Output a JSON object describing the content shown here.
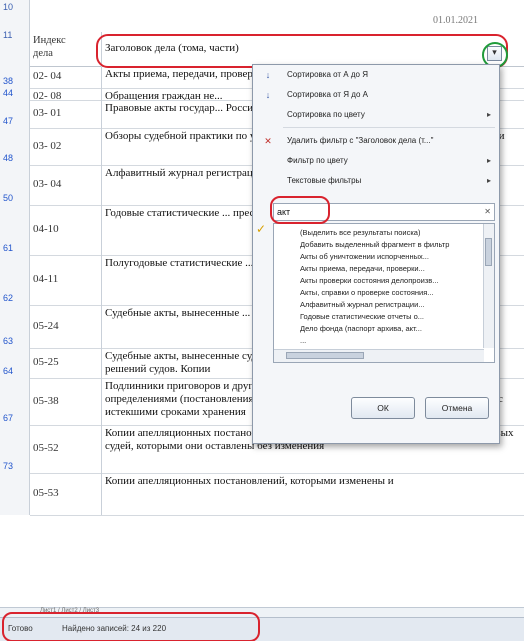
{
  "sheet": {
    "top_row_num": "10",
    "top_right_date": "01.01.2021",
    "header_row_num": "11",
    "header_index": "Индекс\nдела",
    "header_title": "Заголовок дела (тома, части)"
  },
  "rows": [
    {
      "num": "38",
      "idx": "02- 04",
      "text": "Акты приема, передачи, проверки ... смене"
    },
    {
      "num": "44",
      "idx": "02- 08",
      "text": "Обращения граждан не..."
    },
    {
      "num": "47",
      "idx": "03- 01",
      "text": "Правовые акты государ... Российской Федерации"
    },
    {
      "num": "48",
      "idx": "03- 02",
      "text": "Обзоры судебной практики по уголовным делам и делам ... правонарушениях. Копии"
    },
    {
      "num": "50",
      "idx": "03- 04",
      "text": "Алфавитный журнал регистрации ... практики"
    },
    {
      "num": "61",
      "idx": "04-10",
      "text": "Годовые статистические ... преступлений и суммах ... государства, определен..."
    },
    {
      "num": "62",
      "idx": "04-11",
      "text": "Полугодовые статистические ... преступлений и суммах ... государства, определен..."
    },
    {
      "num": "63",
      "idx": "05-24",
      "text": "Судебные акты, вынесенные ... изменении или отмене решений ... судей. Копии"
    },
    {
      "num": "64",
      "idx": "05-25",
      "text": "Судебные акты, вынесенные судом надзорной инстанции, об изменении или отмене решений судов. Копии"
    },
    {
      "num": "67",
      "idx": "05-38",
      "text": "Подлинники приговоров и других судебных актов (и их копии) с последующими определениями (постановлениями) вышестоящих судов, изъятые из уголовных дел с истекшими сроками хранения"
    },
    {
      "num": "73",
      "idx": "05-52",
      "text": "Копии апелляционных постановлений на судебные акты по уголовным делам мировых судей, которыми они оставлены без изменения"
    },
    {
      "num": "",
      "idx": "05-53",
      "text": "Копии апелляционных постановлений, которыми изменены и"
    }
  ],
  "filter_menu": {
    "sort_az": "Сортировка от А до Я",
    "sort_za": "Сортировка от Я до А",
    "sort_color": "Сортировка по цвету",
    "clear_filter": "Удалить фильтр с \"Заголовок дела (т...\"",
    "filter_color": "Фильтр по цвету",
    "text_filters": "Текстовые фильтры",
    "search_value": "акт",
    "items": [
      "(Выделить все результаты поиска)",
      "Добавить выделенный фрагмент в фильтр",
      "Акты об уничтожении испорченных...",
      "Акты приема, передачи, проверки...",
      "Акты проверки состояния делопроизв...",
      "Акты, справки о проверке состояния...",
      "Алфавитный журнал регистрации...",
      "Годовые статистические отчеты о...",
      "Дело фонда (паспорт архива, акт...",
      "..."
    ],
    "ok_label": "ОК",
    "cancel_label": "Отмена"
  },
  "status": {
    "ready": "Готово",
    "found": "Найдено записей: 24 из 220",
    "tabs": "Лист1 / Лист2 / Лист3"
  }
}
